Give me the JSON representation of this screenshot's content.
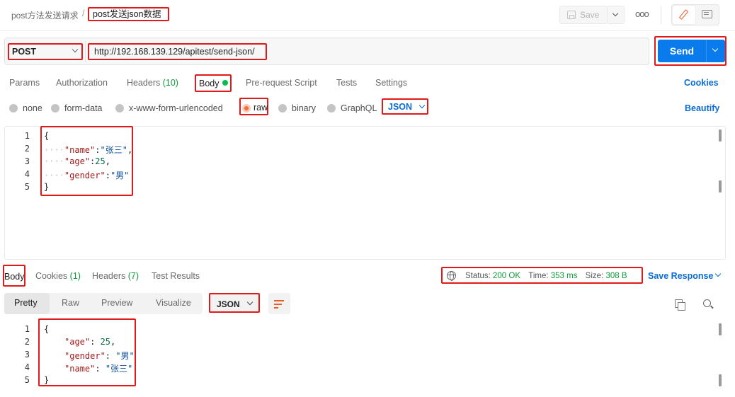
{
  "header": {
    "breadcrumb_parent": "post方法发送请求",
    "breadcrumb_separator": "/",
    "request_name": "post发送json数据",
    "save_label": "Save",
    "more_label": "ooo"
  },
  "request": {
    "method": "POST",
    "url": "http://192.168.139.129/apitest/send-json/",
    "send_label": "Send"
  },
  "request_tabs": {
    "params": "Params",
    "authorization": "Authorization",
    "headers": "Headers",
    "headers_count": "(10)",
    "body": "Body",
    "pre_request": "Pre-request Script",
    "tests": "Tests",
    "settings": "Settings",
    "cookies": "Cookies"
  },
  "body_types": {
    "none": "none",
    "form_data": "form-data",
    "urlencoded": "x-www-form-urlencoded",
    "raw": "raw",
    "binary": "binary",
    "graphql": "GraphQL",
    "format": "JSON",
    "beautify": "Beautify"
  },
  "request_body": {
    "line_numbers": [
      "1",
      "2",
      "3",
      "4",
      "5"
    ],
    "open": "{",
    "indent": "····",
    "key_name": "\"name\"",
    "val_name": "\"张三\"",
    "key_age": "\"age\"",
    "val_age": "25",
    "key_gender": "\"gender\"",
    "val_gender": "\"男\"",
    "close": "}"
  },
  "response_tabs": {
    "body": "Body",
    "cookies": "Cookies",
    "cookies_count": "(1)",
    "headers": "Headers",
    "headers_count": "(7)",
    "test_results": "Test Results"
  },
  "response_status": {
    "status_label": "Status:",
    "status_value": "200 OK",
    "time_label": "Time:",
    "time_value": "353 ms",
    "size_label": "Size:",
    "size_value": "308 B",
    "save_response": "Save Response"
  },
  "response_view": {
    "pretty": "Pretty",
    "raw": "Raw",
    "preview": "Preview",
    "visualize": "Visualize",
    "format": "JSON"
  },
  "response_body": {
    "line_numbers": [
      "1",
      "2",
      "3",
      "4",
      "5"
    ],
    "open": "{",
    "key_age": "\"age\"",
    "val_age": "25",
    "key_gender": "\"gender\"",
    "val_gender": "\"男\"",
    "key_name": "\"name\"",
    "val_name": "\"张三\"",
    "close": "}"
  },
  "colors": {
    "send": "#097bed",
    "highlight": "#e0191b",
    "status_ok": "#0c9a3a",
    "link": "#0a6cd2"
  },
  "icons": [
    "save-icon",
    "chevron-down-icon",
    "more-icon",
    "pencil-icon",
    "comment-icon",
    "globe-icon",
    "wrap-lines-icon",
    "copy-icon",
    "search-icon"
  ]
}
